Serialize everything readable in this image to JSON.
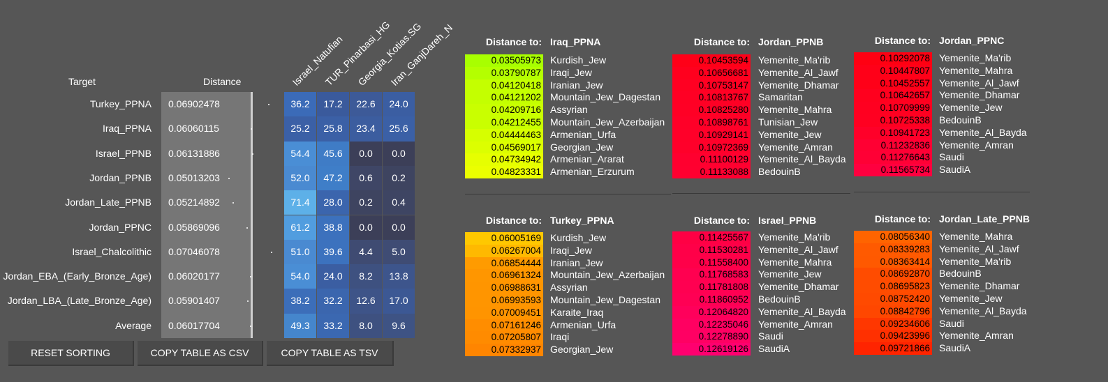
{
  "table": {
    "header_target": "Target",
    "header_distance": "Distance",
    "columns": [
      "Israel_Natufian",
      "TUR_Pinarbasi_HG",
      "Georgia_Kotias.SG",
      "Iran_GanjDareh_N"
    ],
    "rows": [
      {
        "target": "Turkey_PPNA",
        "distance": "0.06902478",
        "values": [
          "36.2",
          "17.2",
          "22.6",
          "24.0"
        ],
        "colors": [
          "#3b6bb8",
          "#3a5a9c",
          "#3d5a98",
          "#3b5ea2"
        ]
      },
      {
        "target": "Iraq_PPNA",
        "distance": "0.06060115",
        "values": [
          "25.2",
          "25.8",
          "23.4",
          "25.6"
        ],
        "colors": [
          "#3b60a6",
          "#3b60a6",
          "#3c5d9f",
          "#3b60a6"
        ]
      },
      {
        "target": "Israel_PPNB",
        "distance": "0.06131886",
        "values": [
          "54.4",
          "45.6",
          "0.0",
          "0.0"
        ],
        "colors": [
          "#4a8ed5",
          "#3f7cc6",
          "#3c3f58",
          "#3c3f58"
        ]
      },
      {
        "target": "Jordan_PPNB",
        "distance": "0.05013203",
        "values": [
          "52.0",
          "47.2",
          "0.6",
          "0.2"
        ],
        "colors": [
          "#4a8ad1",
          "#3f7ec8",
          "#3f4666",
          "#3e4460"
        ]
      },
      {
        "target": "Jordan_Late_PPNB",
        "distance": "0.05214892",
        "values": [
          "71.4",
          "28.0",
          "0.2",
          "0.4"
        ],
        "colors": [
          "#5db0e8",
          "#3b65ad",
          "#3e4460",
          "#3e4563"
        ]
      },
      {
        "target": "Jordan_PPNC",
        "distance": "0.05869096",
        "values": [
          "61.2",
          "38.8",
          "0.0",
          "0.0"
        ],
        "colors": [
          "#519ddf",
          "#3c71bd",
          "#3c3f58",
          "#3c3f58"
        ]
      },
      {
        "target": "Israel_Chalcolithic",
        "distance": "0.07046078",
        "values": [
          "51.0",
          "39.6",
          "4.4",
          "5.0"
        ],
        "colors": [
          "#4a8ad1",
          "#3c72be",
          "#3f4b72",
          "#3f4c74"
        ]
      },
      {
        "target": "Jordan_EBA_(Early_Bronze_Age)",
        "distance": "0.06020177",
        "values": [
          "54.0",
          "24.0",
          "8.2",
          "13.8"
        ],
        "colors": [
          "#4a8ed5",
          "#3b5ea2",
          "#3e5180",
          "#3d558c"
        ]
      },
      {
        "target": "Jordan_LBA_(Late_Bronze_Age)",
        "distance": "0.05901407",
        "values": [
          "38.2",
          "32.2",
          "12.6",
          "17.0"
        ],
        "colors": [
          "#3c6eb9",
          "#3b66ae",
          "#3e5488",
          "#3c5894"
        ]
      },
      {
        "target": "Average",
        "distance": "0.06017704",
        "values": [
          "49.3",
          "33.2",
          "8.0",
          "9.6"
        ],
        "colors": [
          "#4586cc",
          "#3b68b1",
          "#3e5180",
          "#3e5384"
        ]
      }
    ]
  },
  "buttons": {
    "reset": "RESET SORTING",
    "csv": "COPY TABLE AS CSV",
    "tsv": "COPY TABLE AS TSV"
  },
  "panels": [
    {
      "label": "Distance to:",
      "target": "Iraq_PPNA",
      "entries": [
        {
          "d": "0.03505973",
          "pop": "Kurdish_Jew",
          "c": "#a8ff00"
        },
        {
          "d": "0.03790787",
          "pop": "Iraqi_Jew",
          "c": "#b4ff00"
        },
        {
          "d": "0.04120418",
          "pop": "Iranian_Jew",
          "c": "#c4ff00"
        },
        {
          "d": "0.04121202",
          "pop": "Mountain_Jew_Dagestan",
          "c": "#c4ff00"
        },
        {
          "d": "0.04209716",
          "pop": "Assyrian",
          "c": "#c9ff00"
        },
        {
          "d": "0.04212455",
          "pop": "Mountain_Jew_Azerbaijan",
          "c": "#c9ff00"
        },
        {
          "d": "0.04444463",
          "pop": "Armenian_Urfa",
          "c": "#d6ff00"
        },
        {
          "d": "0.04569017",
          "pop": "Georgian_Jew",
          "c": "#dcff00"
        },
        {
          "d": "0.04734942",
          "pop": "Armenian_Ararat",
          "c": "#e6ff00"
        },
        {
          "d": "0.04823331",
          "pop": "Armenian_Erzurum",
          "c": "#ebff00"
        }
      ]
    },
    {
      "label": "Distance to:",
      "target": "Jordan_PPNB",
      "entries": [
        {
          "d": "0.10453594",
          "pop": "Yemenite_Ma'rib",
          "c": "#ff0018"
        },
        {
          "d": "0.10656681",
          "pop": "Yemenite_Al_Jawf",
          "c": "#ff001e"
        },
        {
          "d": "0.10753147",
          "pop": "Yemenite_Dhamar",
          "c": "#ff0022"
        },
        {
          "d": "0.10813767",
          "pop": "Samaritan",
          "c": "#ff0024"
        },
        {
          "d": "0.10825280",
          "pop": "Yemenite_Mahra",
          "c": "#ff0025"
        },
        {
          "d": "0.10898761",
          "pop": "Tunisian_Jew",
          "c": "#ff0028"
        },
        {
          "d": "0.10929141",
          "pop": "Yemenite_Jew",
          "c": "#ff0029"
        },
        {
          "d": "0.10972369",
          "pop": "Yemenite_Amran",
          "c": "#ff002a"
        },
        {
          "d": "0.11100129",
          "pop": "Yemenite_Al_Bayda",
          "c": "#ff002f"
        },
        {
          "d": "0.11133088",
          "pop": "BedouinB",
          "c": "#ff0030"
        }
      ]
    },
    {
      "label": "Distance to:",
      "target": "Jordan_PPNC",
      "entries": [
        {
          "d": "0.10292078",
          "pop": "Yemenite_Ma'rib",
          "c": "#ff0012"
        },
        {
          "d": "0.10447807",
          "pop": "Yemenite_Mahra",
          "c": "#ff0018"
        },
        {
          "d": "0.10452557",
          "pop": "Yemenite_Al_Jawf",
          "c": "#ff0018"
        },
        {
          "d": "0.10642657",
          "pop": "Yemenite_Dhamar",
          "c": "#ff001e"
        },
        {
          "d": "0.10709999",
          "pop": "Yemenite_Jew",
          "c": "#ff0020"
        },
        {
          "d": "0.10725338",
          "pop": "BedouinB",
          "c": "#ff0021"
        },
        {
          "d": "0.10941723",
          "pop": "Yemenite_Al_Bayda",
          "c": "#ff0029"
        },
        {
          "d": "0.11232836",
          "pop": "Yemenite_Amran",
          "c": "#ff0033"
        },
        {
          "d": "0.11276643",
          "pop": "Saudi",
          "c": "#ff0035"
        },
        {
          "d": "0.11565734",
          "pop": "SaudiA",
          "c": "#ff003f"
        }
      ]
    },
    {
      "label": "Distance to:",
      "target": "Turkey_PPNA",
      "entries": [
        {
          "d": "0.06005169",
          "pop": "Kurdish_Jew",
          "c": "#ffc800"
        },
        {
          "d": "0.06267004",
          "pop": "Iraqi_Jew",
          "c": "#ffb900"
        },
        {
          "d": "0.06854444",
          "pop": "Iranian_Jew",
          "c": "#ff9b00"
        },
        {
          "d": "0.06961324",
          "pop": "Mountain_Jew_Azerbaijan",
          "c": "#ff9600"
        },
        {
          "d": "0.06988631",
          "pop": "Assyrian",
          "c": "#ff9500"
        },
        {
          "d": "0.06993593",
          "pop": "Mountain_Jew_Dagestan",
          "c": "#ff9500"
        },
        {
          "d": "0.07009451",
          "pop": "Karaite_Iraq",
          "c": "#ff9400"
        },
        {
          "d": "0.07161246",
          "pop": "Armenian_Urfa",
          "c": "#ff8d00"
        },
        {
          "d": "0.07205807",
          "pop": "Iraqi",
          "c": "#ff8b00"
        },
        {
          "d": "0.07332937",
          "pop": "Georgian_Jew",
          "c": "#ff8500"
        }
      ]
    },
    {
      "label": "Distance to:",
      "target": "Israel_PPNB",
      "entries": [
        {
          "d": "0.11425567",
          "pop": "Yemenite_Ma'rib",
          "c": "#ff0044"
        },
        {
          "d": "0.11530281",
          "pop": "Yemenite_Al_Jawf",
          "c": "#ff0048"
        },
        {
          "d": "0.11558400",
          "pop": "Yemenite_Mahra",
          "c": "#ff0049"
        },
        {
          "d": "0.11768583",
          "pop": "Yemenite_Jew",
          "c": "#ff0050"
        },
        {
          "d": "0.11781808",
          "pop": "Yemenite_Dhamar",
          "c": "#ff0051"
        },
        {
          "d": "0.11860952",
          "pop": "BedouinB",
          "c": "#ff0054"
        },
        {
          "d": "0.12064820",
          "pop": "Yemenite_Al_Bayda",
          "c": "#ff005b"
        },
        {
          "d": "0.12235046",
          "pop": "Yemenite_Amran",
          "c": "#ff0061"
        },
        {
          "d": "0.12278890",
          "pop": "Saudi",
          "c": "#ff0063"
        },
        {
          "d": "0.12619126",
          "pop": "SaudiA",
          "c": "#ff006f"
        }
      ]
    },
    {
      "label": "Distance to:",
      "target": "Jordan_Late_PPNB",
      "entries": [
        {
          "d": "0.08056340",
          "pop": "Yemenite_Mahra",
          "c": "#ff6400"
        },
        {
          "d": "0.08339283",
          "pop": "Yemenite_Al_Jawf",
          "c": "#ff5a00"
        },
        {
          "d": "0.08363414",
          "pop": "Yemenite_Ma'rib",
          "c": "#ff5900"
        },
        {
          "d": "0.08692870",
          "pop": "BedouinB",
          "c": "#ff4c00"
        },
        {
          "d": "0.08695823",
          "pop": "Yemenite_Dhamar",
          "c": "#ff4c00"
        },
        {
          "d": "0.08752420",
          "pop": "Yemenite_Jew",
          "c": "#ff4a00"
        },
        {
          "d": "0.08842796",
          "pop": "Yemenite_Al_Bayda",
          "c": "#ff4700"
        },
        {
          "d": "0.09234606",
          "pop": "Saudi",
          "c": "#ff3700"
        },
        {
          "d": "0.09423996",
          "pop": "Yemenite_Amran",
          "c": "#ff3000"
        },
        {
          "d": "0.09721866",
          "pop": "SaudiA",
          "c": "#ff2400"
        }
      ]
    }
  ]
}
